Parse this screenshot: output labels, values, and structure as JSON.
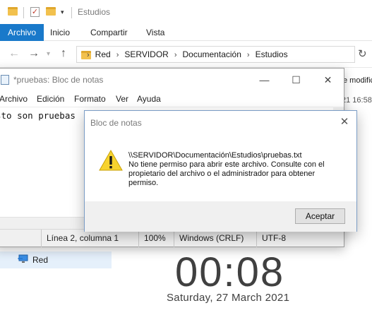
{
  "explorer": {
    "quick_access_title": "Estudios",
    "ribbon_tabs": [
      "Archivo",
      "Inicio",
      "Compartir",
      "Vista"
    ],
    "address": {
      "crumbs": [
        "Red",
        "SERVIDOR",
        "Documentación",
        "Estudios"
      ]
    },
    "right_column": {
      "header_fragment": "e modific",
      "date_fragment": "21 16:58"
    },
    "nav_pane": {
      "network_label": "Red"
    }
  },
  "notepad": {
    "title": "*pruebas: Bloc de notas",
    "menu": [
      "Archivo",
      "Edición",
      "Formato",
      "Ver",
      "Ayuda"
    ],
    "content": "sto son pruebas",
    "status": {
      "position": "Línea 2, columna 1",
      "zoom": "100%",
      "line_ending": "Windows (CRLF)",
      "encoding": "UTF-8"
    }
  },
  "dialog": {
    "title": "Bloc de notas",
    "path": "\\\\SERVIDOR\\Documentación\\Estudios\\pruebas.txt",
    "message": "No tiene permiso para abrir este archivo. Consulte con el propietario del archivo o el administrador para obtener permiso.",
    "ok_label": "Aceptar"
  },
  "clock": {
    "time": "00:08",
    "date": "Saturday, 27 March 2021"
  },
  "colors": {
    "ribbon_active": "#1979ca",
    "folder": "#f2c14e",
    "warning": "#f7d32e"
  },
  "icons": {
    "folder": "folder-icon",
    "properties": "properties-check-icon",
    "network": "network-icon",
    "warning": "warning-icon",
    "notepad": "notepad-icon"
  }
}
